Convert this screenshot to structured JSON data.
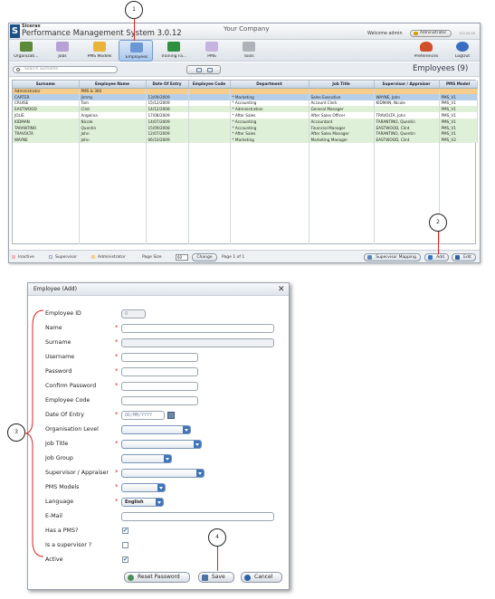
{
  "app": {
    "brand": "Sicerax",
    "title": "Performance Management System 3.0.12",
    "company": "Your Company",
    "welcome": "Welcome admin",
    "role": "Administrator",
    "version": "120.20.48"
  },
  "nav": {
    "items": [
      {
        "label": "Organizati...",
        "icon": "organization-icon",
        "color": "#5a8a3a"
      },
      {
        "label": "Jobs",
        "icon": "jobs-icon",
        "color": "#8f6bb5"
      },
      {
        "label": "PMS Models",
        "icon": "pms-models-icon",
        "color": "#e0a020"
      },
      {
        "label": "Employees",
        "icon": "employees-icon",
        "color": "#4a7fc4"
      },
      {
        "label": "Training Fa...",
        "icon": "training-icon",
        "color": "#2f8f3f"
      },
      {
        "label": "PMS",
        "icon": "pms-icon",
        "color": "#9b6fc2"
      },
      {
        "label": "Tools",
        "icon": "tools-icon",
        "color": "#8a8f96"
      }
    ],
    "right": [
      {
        "label": "Preferences",
        "icon": "heart-icon",
        "color": "#d0502a"
      },
      {
        "label": "LogOut",
        "icon": "power-icon",
        "color": "#3a6fc0"
      }
    ]
  },
  "toolbar": {
    "search_placeholder": "Search  Surname",
    "section_title": "Employees (9)"
  },
  "grid": {
    "columns": [
      "Surname",
      "Employee Name",
      "Date Of Entry",
      "Employee Code",
      "Department",
      "Job Title",
      "Supervisor / Appraiser",
      "PMS Model"
    ],
    "rows": [
      {
        "type": "admin",
        "cells": [
          "Administrator",
          "PMS & 360",
          "",
          "",
          "",
          "",
          "",
          ""
        ]
      },
      {
        "type": "sel",
        "cells": [
          "CARTER",
          "Jimmy",
          "13/09/2009",
          "",
          "* Marketing",
          "Sales Executive",
          "WAYNE, John",
          "PMS_V1"
        ]
      },
      {
        "type": "norm",
        "cells": [
          "CRUISE",
          "Tom",
          "15/12/2009",
          "",
          "* Accounting",
          "Account Clerk",
          "KIDMAN, Nicole",
          "PMS_V1"
        ]
      },
      {
        "type": "sup",
        "cells": [
          "EASTWOOD",
          "Clint",
          "14/12/2008",
          "",
          "* Administration",
          "General Manager",
          "",
          "PMS_V1"
        ]
      },
      {
        "type": "norm",
        "cells": [
          "JOLIE",
          "Angelina",
          "17/08/2009",
          "",
          "* After Sales",
          "After Sales Officer",
          "TRAVOLTA, John",
          "PMS_V1"
        ]
      },
      {
        "type": "sup",
        "cells": [
          "KIDMAN",
          "Nicole",
          "14/07/2009",
          "",
          "* Accounting",
          "Accountant",
          "TARANTINO, Quentin",
          "PMS_V1"
        ]
      },
      {
        "type": "sup",
        "cells": [
          "TARANTINO",
          "Quentin",
          "15/09/2008",
          "",
          "* Accounting",
          "Financial Manager",
          "EASTWOOD, Clint",
          "PMS_V1"
        ]
      },
      {
        "type": "sup",
        "cells": [
          "TRAVOLTA",
          "John",
          "12/07/2009",
          "",
          "* After Sales",
          "After Sales Manager",
          "TARANTINO, Quentin",
          "PMS_V1"
        ]
      },
      {
        "type": "sup",
        "cells": [
          "WAYNE",
          "John",
          "06/10/2009",
          "",
          "* Marketing",
          "Marketing Manager",
          "EASTWOOD, Clint",
          "PMS_V2"
        ]
      }
    ]
  },
  "footer": {
    "legend_inactive": "Inactive",
    "legend_supervisor": "Supervisor",
    "legend_admin": "Administrator",
    "page_size_label": "Page Size",
    "page_size_value": "60",
    "change_label": "Change",
    "page_info": "Page 1 of 1",
    "supervisor_mapping": "Supervisor Mapping",
    "add": "Add",
    "edit": "Edit",
    "colors": {
      "inactive": "#f4b6b6",
      "supervisor": "#dff0d8",
      "admin": "#f7cd8b"
    }
  },
  "dialog": {
    "title": "Employee (Add)",
    "employee_id_value": "0",
    "date_placeholder": "DD/MM/YYYY",
    "language_value": "English",
    "labels": {
      "employee_id": "Employee ID",
      "name": "Name",
      "surname": "Surname",
      "username": "Username",
      "password": "Password",
      "confirm_password": "Confirm Password",
      "employee_code": "Employee Code",
      "date_of_entry": "Date Of Entry",
      "org_level": "Organisation Level",
      "job_title": "Job Title",
      "job_group": "Job Group",
      "supervisor": "Supervisor / Appraiser",
      "pms_models": "PMS Models",
      "language": "Language",
      "email": "E-Mail",
      "has_pms": "Has a PMS?",
      "is_supervisor": "Is a supervisor ?",
      "active": "Active"
    },
    "checks": {
      "has_pms": "✔",
      "is_supervisor": "",
      "active": "✔"
    },
    "buttons": {
      "reset": "Reset Password",
      "save": "Save",
      "cancel": "Cancel"
    }
  },
  "callouts": {
    "c1": "1",
    "c2": "2",
    "c3": "3",
    "c4": "4"
  }
}
